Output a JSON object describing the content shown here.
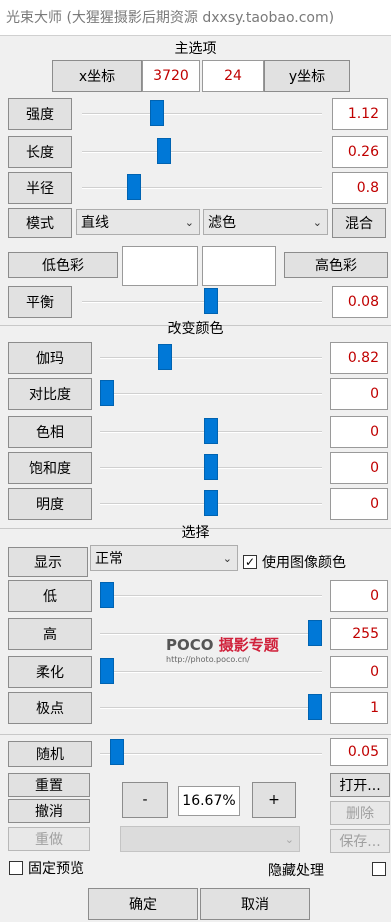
{
  "window": {
    "title": "光束大师 (大猩猩摄影后期资源 dxxsy.taobao.com)"
  },
  "main": {
    "section_title": "主选项",
    "x_label": "x坐标",
    "x_value": "3720",
    "y_value": "24",
    "y_label": "y坐标",
    "sliders": [
      {
        "label": "强度",
        "value": "1.12",
        "level": 0.3
      },
      {
        "label": "长度",
        "value": "0.26",
        "level": 0.33
      },
      {
        "label": "半径",
        "value": "0.8",
        "level": 0.2
      }
    ],
    "mode_label": "模式",
    "mode_select": "直线",
    "blend_select": "滤色",
    "mix_button": "混合",
    "low_color_button": "低色彩",
    "high_color_button": "高色彩",
    "balance": {
      "label": "平衡",
      "value": "0.08",
      "level": 0.54
    }
  },
  "color": {
    "section_title": "改变颜色",
    "sliders": [
      {
        "label": "伽玛",
        "value": "0.82",
        "level": 0.28
      },
      {
        "label": "对比度",
        "value": "0",
        "level": 0.0
      },
      {
        "label": "色相",
        "value": "0",
        "level": 0.5
      },
      {
        "label": "饱和度",
        "value": "0",
        "level": 0.5
      },
      {
        "label": "明度",
        "value": "0",
        "level": 0.5
      }
    ]
  },
  "select": {
    "section_title": "选择",
    "show_button": "显示",
    "show_select": "正常",
    "use_image_color_label": "使用图像颜色",
    "use_image_color_checked": true,
    "sliders": [
      {
        "label": "低",
        "value": "0",
        "level": 0.0
      },
      {
        "label": "高",
        "value": "255",
        "level": 1.0
      },
      {
        "label": "柔化",
        "value": "0",
        "level": 0.0
      },
      {
        "label": "极点",
        "value": "1",
        "level": 1.0
      }
    ]
  },
  "watermark": {
    "logo_a": "POCO",
    "logo_b": "摄影专题",
    "url": "http://photo.poco.cn/"
  },
  "bottom": {
    "random_button": "随机",
    "random_value": "0.05",
    "random_level": 0.03,
    "reset_button": "重置",
    "undo_button": "撤消",
    "redo_button": "重做",
    "minus_button": "-",
    "zoom_value": "16.67%",
    "plus_button": "+",
    "open_button": "打开...",
    "delete_button": "删除",
    "save_button": "保存...",
    "fixed_preview_label": "固定预览",
    "fixed_preview_checked": false,
    "hide_process_label": "隐藏处理",
    "hide_process_checked": false,
    "ok_button": "确定",
    "cancel_button": "取消"
  }
}
